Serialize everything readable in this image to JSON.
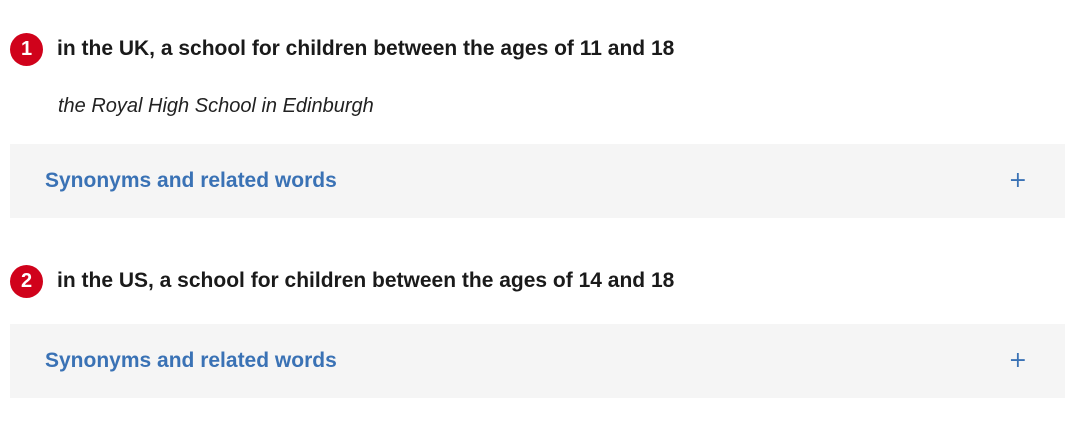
{
  "senses": [
    {
      "number": "1",
      "definition": "in the UK, a school for children between the ages of 11 and 18",
      "example": "the Royal High School in Edinburgh",
      "accordion_label": "Synonyms and related words",
      "accordion_icon": "+"
    },
    {
      "number": "2",
      "definition": "in the US, a school for children between the ages of 14 and 18",
      "accordion_label": "Synonyms and related words",
      "accordion_icon": "+"
    }
  ],
  "colors": {
    "sense_badge": "#d0021b",
    "link_blue": "#3a72b5",
    "accordion_bg": "#f5f5f5"
  }
}
